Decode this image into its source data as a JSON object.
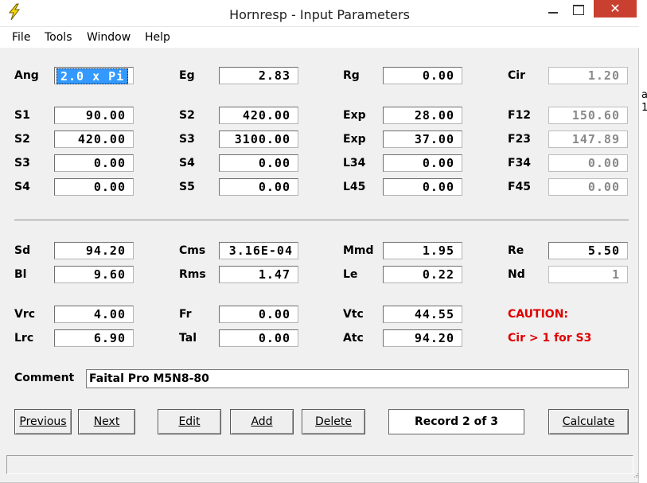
{
  "window": {
    "title": "Hornresp - Input Parameters",
    "icon": "lightning-bolt-icon",
    "close_glyph": "✕"
  },
  "menu": [
    "File",
    "Tools",
    "Window",
    "Help"
  ],
  "horn": {
    "Ang": "2.0 x Pi",
    "Eg": "2.83",
    "Rg": "0.00",
    "Cir": "1.20",
    "S1": "90.00",
    "S2a": "420.00",
    "Exp1": "28.00",
    "F12": "150.60",
    "S2b": "420.00",
    "S3a": "3100.00",
    "Exp2": "37.00",
    "F23": "147.89",
    "S3b": "0.00",
    "S4a": "0.00",
    "L34": "0.00",
    "F34": "0.00",
    "S4b": "0.00",
    "S5": "0.00",
    "L45": "0.00",
    "F45": "0.00"
  },
  "labels": {
    "ang": "Ang",
    "eg": "Eg",
    "rg": "Rg",
    "cir": "Cir",
    "s1": "S1",
    "s2": "S2",
    "exp": "Exp",
    "f12": "F12",
    "s3": "S3",
    "f23": "F23",
    "s4": "S4",
    "l34": "L34",
    "f34": "F34",
    "s5": "S5",
    "l45": "L45",
    "f45": "F45",
    "sd": "Sd",
    "cms": "Cms",
    "mmd": "Mmd",
    "re": "Re",
    "bl": "Bl",
    "rms": "Rms",
    "le": "Le",
    "nd": "Nd",
    "vrc": "Vrc",
    "fr": "Fr",
    "vtc": "Vtc",
    "lrc": "Lrc",
    "tal": "Tal",
    "atc": "Atc",
    "comment": "Comment"
  },
  "driver": {
    "Sd": "94.20",
    "Cms": "3.16E-04",
    "Mmd": "1.95",
    "Re": "5.50",
    "Bl": "9.60",
    "Rms": "1.47",
    "Le": "0.22",
    "Nd": "1",
    "Vrc": "4.00",
    "Fr": "0.00",
    "Vtc": "44.55",
    "Lrc": "6.90",
    "Tal": "0.00",
    "Atc": "94.20"
  },
  "caution": {
    "title": "CAUTION:",
    "message": "Cir > 1 for S3"
  },
  "comment": "Faital Pro M5N8-80",
  "buttons": {
    "previous": "Previous",
    "next": "Next",
    "edit": "Edit",
    "add": "Add",
    "delete": "Delete",
    "calculate": "Calculate"
  },
  "record": "Record 2 of 3",
  "side_fragment": [
    "a",
    "1"
  ]
}
